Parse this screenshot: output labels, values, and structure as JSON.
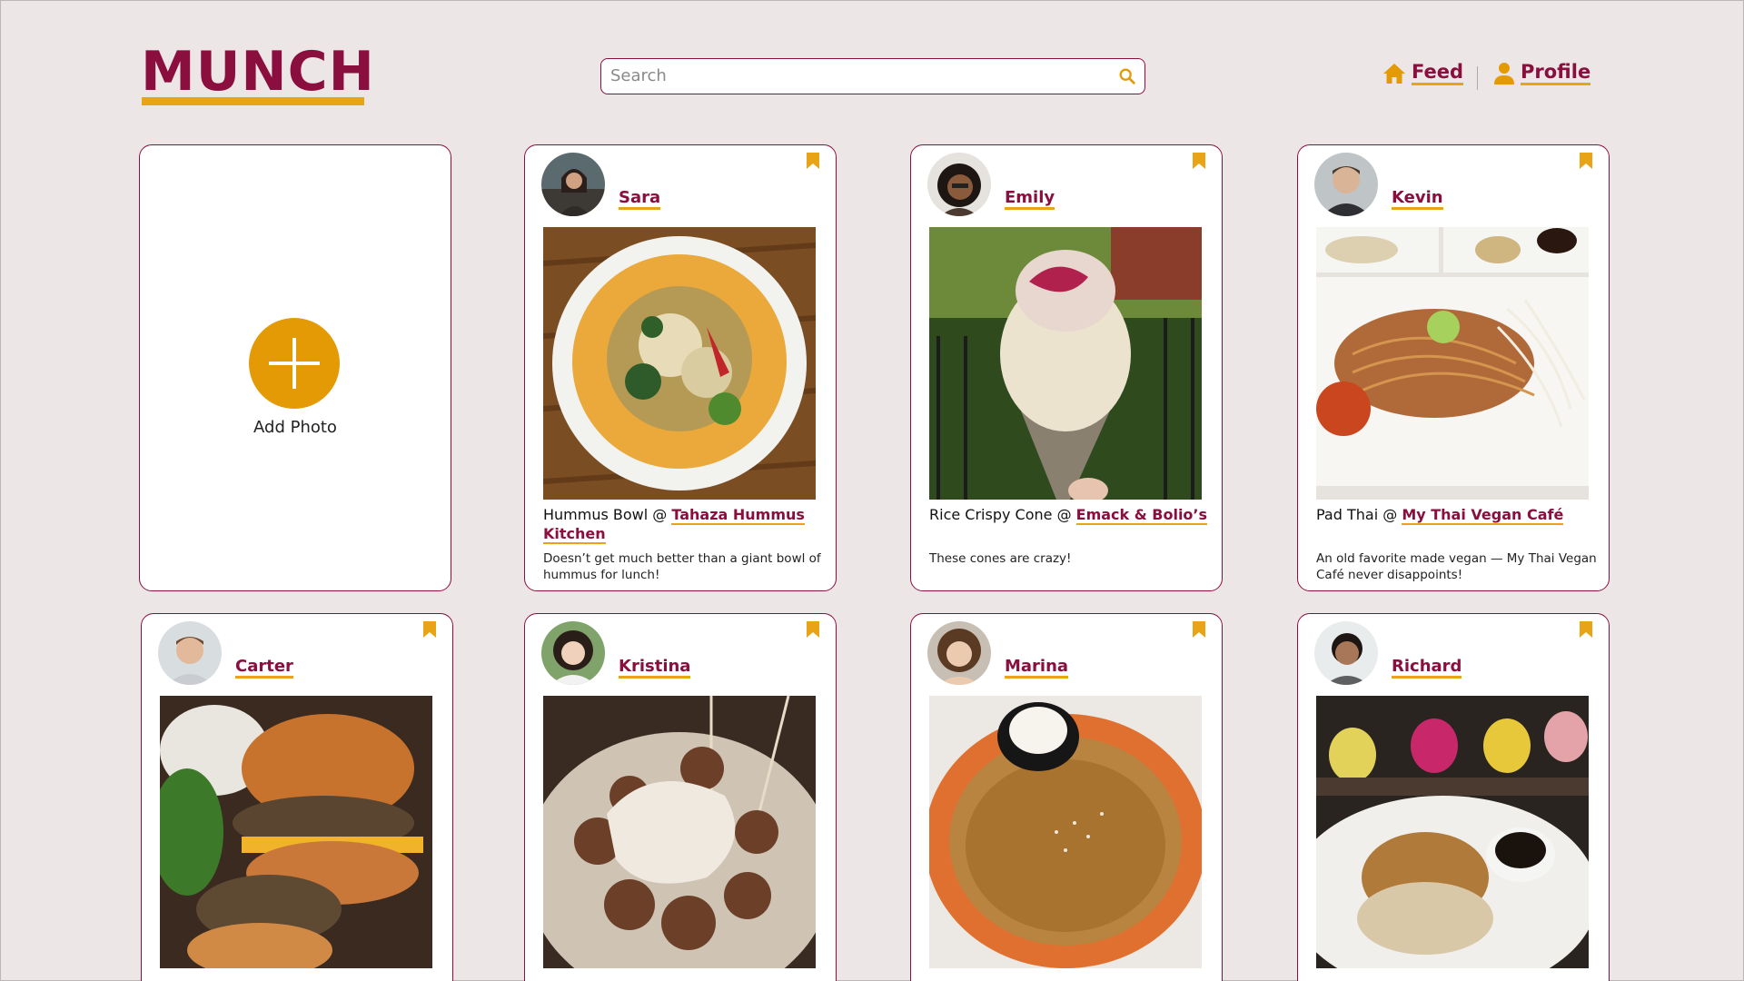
{
  "app": {
    "logo": "MUNCH"
  },
  "search": {
    "placeholder": "Search"
  },
  "nav": {
    "feed_label": "Feed",
    "profile_label": "Profile"
  },
  "add_card": {
    "label": "Add Photo"
  },
  "colors": {
    "brand": "#8a0f3e",
    "accent": "#e8a317",
    "add_button": "#e39a05",
    "background": "#ede6e6"
  },
  "posts": [
    {
      "user": "Sara",
      "dish": "Hummus Bowl @ ",
      "place": "Tahaza Hummus Kitchen",
      "description": "Doesn’t get much better than a giant bowl of hummus for lunch!"
    },
    {
      "user": "Emily",
      "dish": "Rice Crispy Cone @ ",
      "place": "Emack & Bolio’s",
      "description": "These cones are crazy!"
    },
    {
      "user": "Kevin",
      "dish": "Pad Thai @ ",
      "place": "My Thai Vegan Café",
      "description": "An old favorite made vegan — My Thai Vegan Café never disappoints!"
    },
    {
      "user": "Carter"
    },
    {
      "user": "Kristina"
    },
    {
      "user": "Marina"
    },
    {
      "user": "Richard"
    }
  ]
}
